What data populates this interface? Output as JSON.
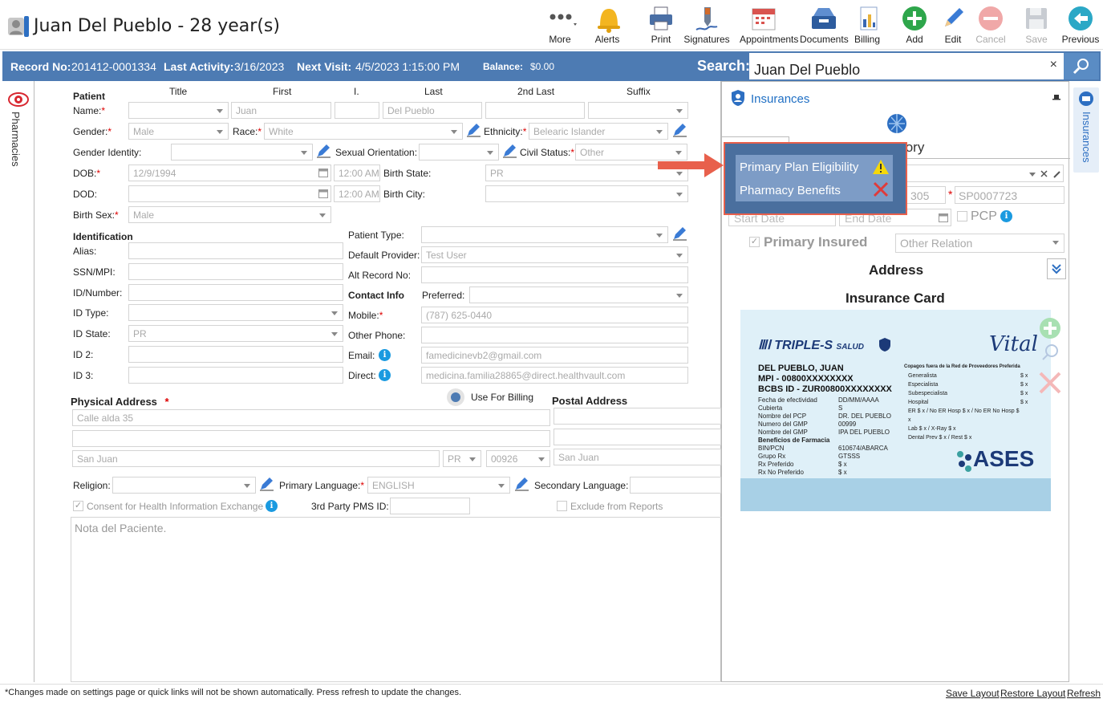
{
  "header": {
    "title": "Juan Del Pueblo - 28 year(s)",
    "toolbar": [
      {
        "name": "more",
        "label": "More",
        "icon": "more-dots-icon"
      },
      {
        "name": "alerts",
        "label": "Alerts",
        "icon": "bell-icon"
      },
      {
        "name": "print",
        "label": "Print",
        "icon": "printer-icon"
      },
      {
        "name": "signatures",
        "label": "Signatures",
        "icon": "signature-pen-icon"
      },
      {
        "name": "appointments",
        "label": "Appointments",
        "icon": "calendar-icon"
      },
      {
        "name": "documents",
        "label": "Documents",
        "icon": "inbox-tray-icon"
      },
      {
        "name": "billing",
        "label": "Billing",
        "icon": "billing-report-icon"
      },
      {
        "name": "add",
        "label": "Add",
        "icon": "plus-circle-icon"
      },
      {
        "name": "edit",
        "label": "Edit",
        "icon": "pencil-icon"
      },
      {
        "name": "cancel",
        "label": "Cancel",
        "icon": "minus-circle-icon"
      },
      {
        "name": "save",
        "label": "Save",
        "icon": "floppy-disk-icon"
      },
      {
        "name": "previous",
        "label": "Previous",
        "icon": "back-arrow-icon"
      }
    ]
  },
  "bar": {
    "record_label": "Record No:",
    "record_value": "201412-0001334",
    "activity_label": "Last Activity:",
    "activity_value": "3/16/2023",
    "visit_label": "Next Visit:",
    "visit_value": "4/5/2023 1:15:00 PM",
    "balance_label": "Balance:",
    "balance_value": "$0.00",
    "search_label": "Search:",
    "search_value": "Juan Del Pueblo",
    "clear": "×"
  },
  "left_tab": "Pharmacies",
  "right_tab": "Insurances",
  "patient": {
    "heading": "Patient",
    "cols": {
      "title": "Title",
      "first": "First",
      "initial": "I.",
      "last": "Last",
      "second_last": "2nd Last",
      "suffix": "Suffix"
    },
    "name_label": "Name:",
    "first": "Juan",
    "last": "Del Pueblo",
    "gender_label": "Gender:",
    "gender": "Male",
    "race_label": "Race:",
    "race": "White",
    "ethnicity_label": "Ethnicity:",
    "ethnicity": "Belearic Islander",
    "gender_identity_label": "Gender Identity:",
    "sexual_orientation_label": "Sexual Orientation:",
    "civil_status_label": "Civil Status:",
    "civil_status": "Other",
    "dob_label": "DOB:",
    "dob": "12/9/1994",
    "dob_time": "12:00 AM",
    "birth_state_label": "Birth State:",
    "birth_state": "PR",
    "dod_label": "DOD:",
    "dod_time": "12:00 AM",
    "birth_city_label": "Birth City:",
    "birth_sex_label": "Birth Sex:",
    "birth_sex": "Male"
  },
  "identification": {
    "heading": "Identification",
    "alias_label": "Alias:",
    "ssn_label": "SSN/MPI:",
    "idnum_label": "ID/Number:",
    "idtype_label": "ID Type:",
    "idstate_label": "ID State:",
    "idstate": "PR",
    "id2_label": "ID 2:",
    "id3_label": "ID 3:",
    "patient_type_label": "Patient Type:",
    "default_provider_label": "Default Provider:",
    "default_provider": "Test User",
    "alt_record_label": "Alt Record No:",
    "contact_heading": "Contact Info",
    "preferred_label": "Preferred:",
    "mobile_label": "Mobile:",
    "mobile": "(787) 625-0440",
    "other_phone_label": "Other Phone:",
    "email_label": "Email:",
    "email": "famedicinevb2@gmail.com",
    "direct_label": "Direct:",
    "direct": "medicina.familia28865@direct.healthvault.com",
    "info": "i"
  },
  "address": {
    "physical_heading": "Physical Address",
    "postal_heading": "Postal Address",
    "use_for_billing": "Use For Billing",
    "line1": "Calle alda 35",
    "city": "San Juan",
    "state": "PR",
    "zip": "00926",
    "postal_city": "San Juan"
  },
  "misc": {
    "religion_label": "Religion:",
    "primary_language_label": "Primary Language:",
    "primary_language": "ENGLISH",
    "secondary_language_label": "Secondary Language:",
    "consent_label": "Consent for Health Information Exchange",
    "third_party_label": "3rd Party PMS ID:",
    "exclude_label": "Exclude from Reports",
    "notes_placeholder": "Nota del Paciente."
  },
  "insurance": {
    "title": "Insurances",
    "tab_partial": "tory",
    "policy_partial": "305",
    "policy_req": "*",
    "policy": "SP0007723",
    "start_date": "Start Date",
    "end_date": "End Date",
    "pcp_label": "PCP",
    "primary_insured": "Primary Insured",
    "other_relation": "Other Relation",
    "address_heading": "Address",
    "card_heading": "Insurance Card"
  },
  "popup": {
    "items": [
      {
        "label": "Primary Plan Eligibility",
        "status_icon": "warning-triangle-icon"
      },
      {
        "label": "Pharmacy Benefits",
        "status_icon": "red-x-icon"
      }
    ]
  },
  "card": {
    "brand": "TRIPLE-S",
    "brand_sub": "SALUD",
    "vital": "Vital",
    "name": "DEL PUEBLO, JUAN",
    "mpi": "MPI - 00800XXXXXXXX",
    "bcbs": "BCBS ID - ZUR00800XXXXXXXX",
    "left_rows": [
      [
        "Fecha de efectividad",
        "DD/MM/AAAA"
      ],
      [
        "Cubierta",
        "S"
      ],
      [
        "Nombre del PCP",
        "DR. DEL PUEBLO"
      ],
      [
        "Numero del GMP",
        "00999"
      ],
      [
        "Nombre del GMP",
        "IPA DEL PUEBLO"
      ]
    ],
    "pharm_heading": "Beneficios de Farmacia",
    "pharm_rows": [
      [
        "BIN/PCN",
        "610674/ABARCA"
      ],
      [
        "Grupo Rx",
        "GTSSS"
      ],
      [
        "Rx Preferido",
        "$ x"
      ],
      [
        "Rx No Preferido",
        "$ x"
      ]
    ],
    "copay_heading": "Copagos fuera de la Red de Proveedores Preferida",
    "copay_rows": [
      [
        "Generalista",
        "$ x"
      ],
      [
        "Especialista",
        "$ x"
      ],
      [
        "Subespecialista",
        "$ x"
      ],
      [
        "Hospital",
        "$ x"
      ],
      [
        "ER $ x / No ER Hosp $ x / No ER No Hosp $ x",
        ""
      ],
      [
        "Lab $ x / X-Ray $ x",
        ""
      ],
      [
        "Dental Prev $ x / Rest $ x",
        ""
      ]
    ],
    "ases": "ASES"
  },
  "footer": {
    "note": "*Changes made on settings page or quick links will not be shown automatically. Press refresh to update the changes.",
    "save_layout": "Save Layout",
    "restore_layout": "Restore Layout",
    "refresh": "Refresh"
  }
}
